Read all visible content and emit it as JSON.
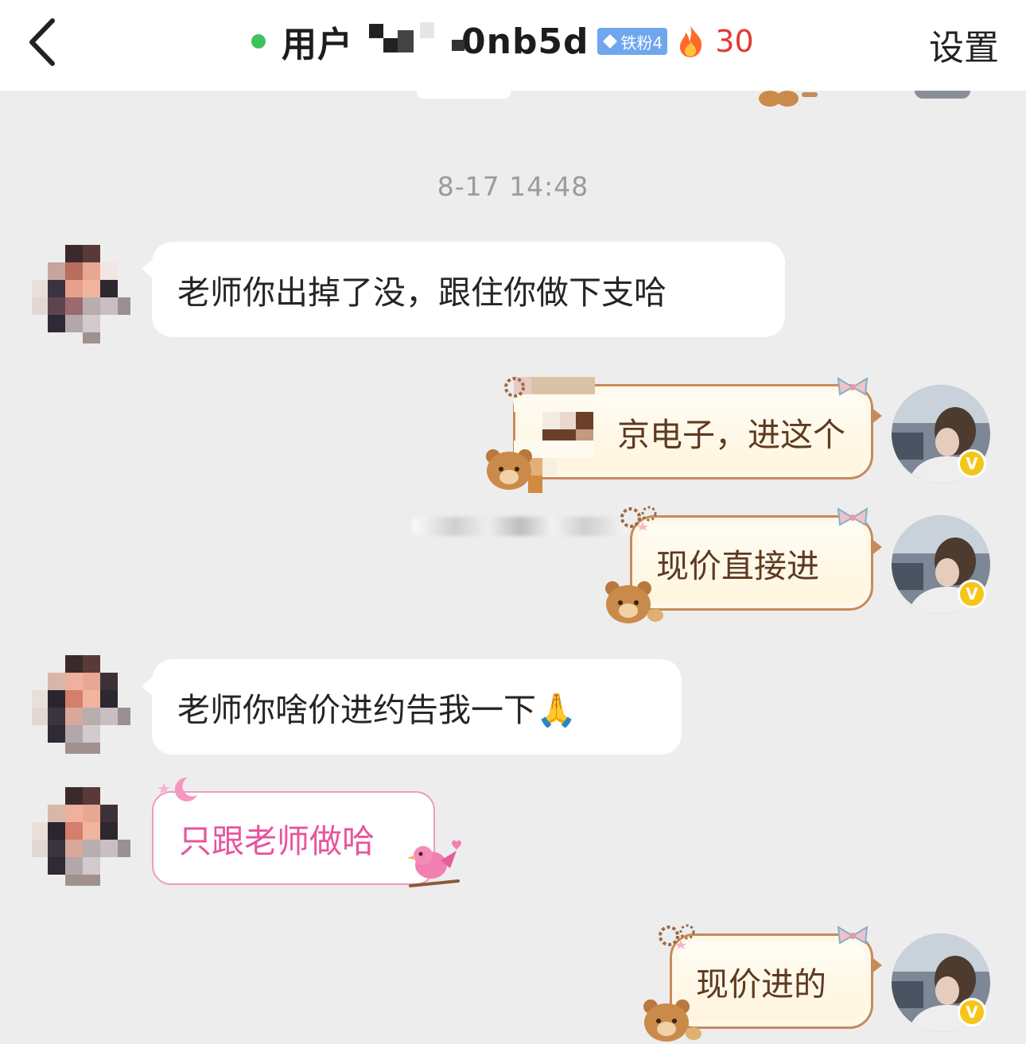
{
  "header": {
    "back_icon": "chevron-left-icon",
    "title": "用户",
    "title_suffix": "0nb5d",
    "fan_badge": "铁粉4",
    "fan_badge_icon": "diamond-icon",
    "fire_icon": "fire-icon",
    "streak_count": "30",
    "settings_label": "设置",
    "online_color": "#3bc45b"
  },
  "chat": {
    "timestamp": "8-17 14:48",
    "messages": [
      {
        "side": "left",
        "style": "plain",
        "text": "老师你出掉了没，跟住你做下支哈"
      },
      {
        "side": "right",
        "style": "bear",
        "text": "京电子，进这个"
      },
      {
        "side": "right",
        "style": "bear",
        "text": "现价直接进"
      },
      {
        "side": "left",
        "style": "plain",
        "text": "老师你啥价进约告我一下🙏"
      },
      {
        "side": "left",
        "style": "pink",
        "text": "只跟老师做哈"
      },
      {
        "side": "right",
        "style": "bear",
        "text": "现价进的"
      }
    ],
    "verified_badge": "V"
  },
  "colors": {
    "bubble_bear_border": "#c78a59",
    "bubble_pink_text": "#e8549c",
    "streak": "#e03a2e",
    "badge": "#6fa6ee"
  }
}
